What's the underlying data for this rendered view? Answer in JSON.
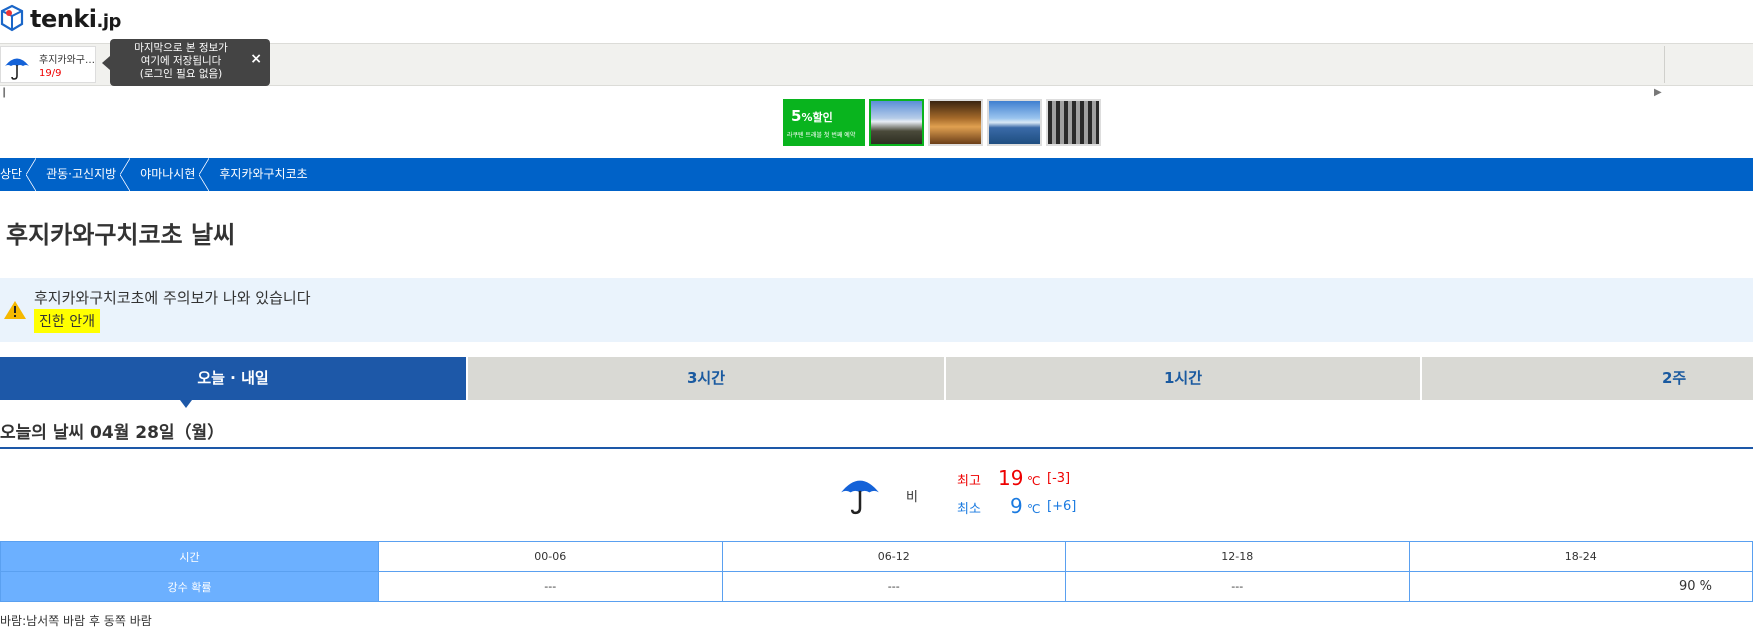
{
  "header": {
    "logo_text": "tenki",
    "logo_suffix": ".jp"
  },
  "history": {
    "location": "후지카와구…",
    "temps": "19/9",
    "tooltip": {
      "line1": "마지막으로 본 정보가",
      "line2": "여기에 저장됩니다",
      "line3": "(로그인 필요 없음)",
      "close": "×"
    },
    "scroll_left": "❙",
    "scroll_right": "▶"
  },
  "ad": {
    "promo_big": "5",
    "promo_unit": "%할인",
    "promo_small": "라쿠텐 트래블 첫 번째 예약",
    "colors": {
      "promo": "#09b41e"
    }
  },
  "breadcrumb": [
    "상단",
    "관동·고신지방",
    "야마나시현",
    "후지카와구치코초"
  ],
  "page_title": "후지카와구치코초 날씨",
  "warning": {
    "message": "후지카와구치코초에 주의보가 나와 있습니다",
    "badge": "진한 안개"
  },
  "tabs": [
    {
      "label": "오늘 · 내일",
      "active": true
    },
    {
      "label": "3시간",
      "active": false
    },
    {
      "label": "1시간",
      "active": false
    },
    {
      "label": "2주",
      "active": false
    }
  ],
  "today": {
    "heading": "오늘의 날씨 04월 28일（월）",
    "weather": "비",
    "weather_icon": "umbrella-icon",
    "high_label": "최고",
    "high": "19",
    "high_diff": "[-3]",
    "low_label": "최소",
    "low": "9",
    "low_diff": "[+6]",
    "unit": "℃"
  },
  "precip_table": {
    "row_time_label": "시간",
    "row_prob_label": "강수 확률",
    "times": [
      "00-06",
      "06-12",
      "12-18",
      "18-24"
    ],
    "probs": [
      "---",
      "---",
      "---",
      "90 %"
    ]
  },
  "wind": "바람:남서쪽 바람 후 동쪽 바람",
  "colors": {
    "brand_blue": "#0062c8",
    "tab_active": "#1d58a8",
    "high": "#e00000",
    "low": "#1a7ae0",
    "warning_badge": "#ffff00"
  }
}
